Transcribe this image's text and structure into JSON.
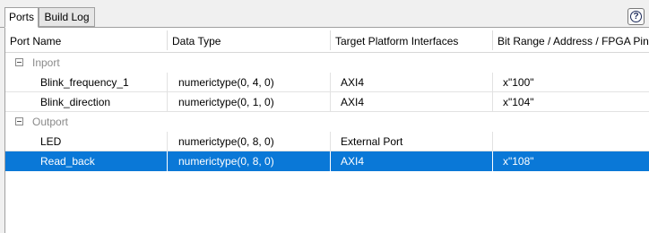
{
  "tabs": [
    {
      "label": "Ports",
      "active": true
    },
    {
      "label": "Build Log",
      "active": false
    }
  ],
  "help": {
    "glyph": "?",
    "icon": "help-icon"
  },
  "columns": [
    "Port Name",
    "Data Type",
    "Target Platform Interfaces",
    "Bit Range / Address / FPGA Pin"
  ],
  "groups": [
    {
      "label": "Inport",
      "rows": [
        {
          "name": "Blink_frequency_1",
          "type": "numerictype(0, 4, 0)",
          "interface": "AXI4",
          "address": "x\"100\""
        },
        {
          "name": "Blink_direction",
          "type": "numerictype(0, 1, 0)",
          "interface": "AXI4",
          "address": "x\"104\""
        }
      ]
    },
    {
      "label": "Outport",
      "rows": [
        {
          "name": "LED",
          "type": "numerictype(0, 8, 0)",
          "interface": "External Port",
          "address": ""
        },
        {
          "name": "Read_back",
          "type": "numerictype(0, 8, 0)",
          "interface": "AXI4",
          "address": "x\"108\"",
          "selected": true
        }
      ]
    }
  ],
  "colors": {
    "selection": "#0a78d7",
    "group_text": "#8a8a8a"
  }
}
